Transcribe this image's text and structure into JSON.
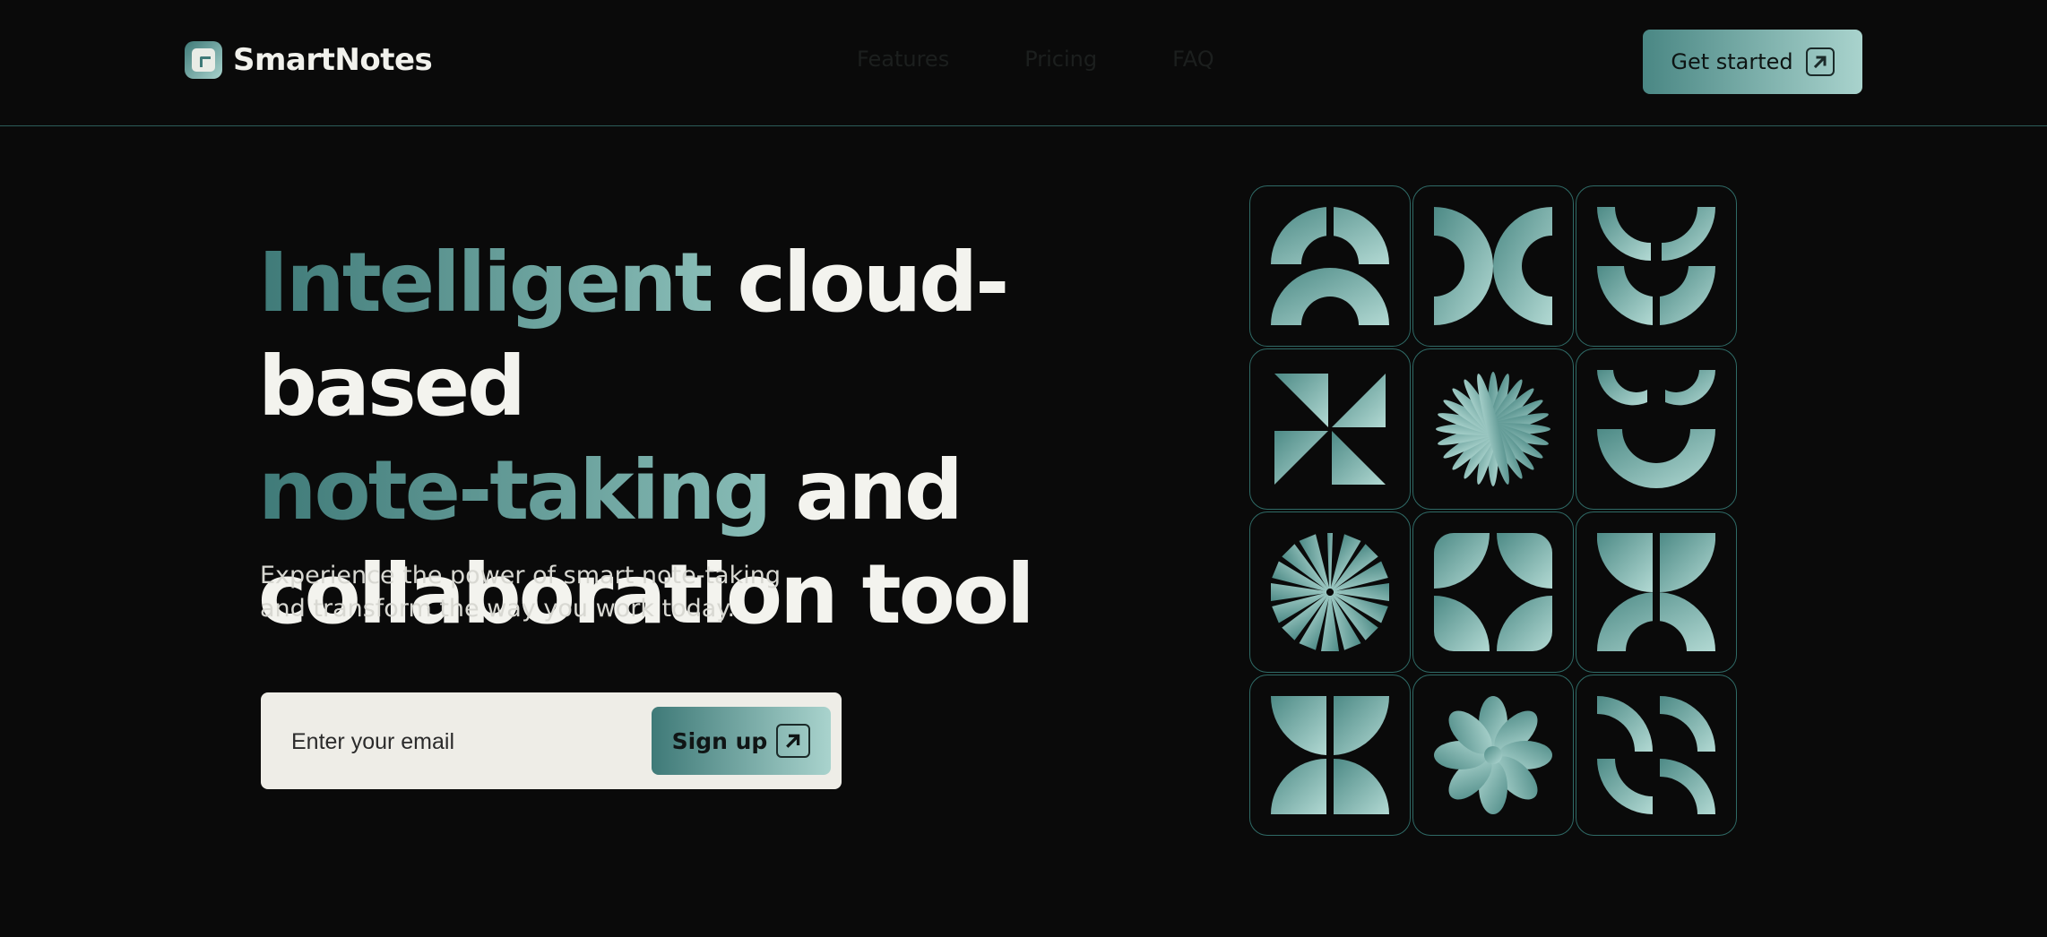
{
  "brand": {
    "name": "SmartNotes"
  },
  "nav": {
    "features": "Features",
    "pricing": "Pricing",
    "faq": "FAQ"
  },
  "header": {
    "cta_label": "Get started"
  },
  "hero": {
    "headline_accent_1": "Intelligent",
    "headline_plain_1": " cloud-based",
    "headline_accent_2": "note-taking",
    "headline_plain_2": " and",
    "headline_plain_3": "collaboration tool",
    "subtext": "Experience the power of smart note-taking and transform the way you work today."
  },
  "signup": {
    "placeholder": "Enter your email",
    "button_label": "Sign up"
  },
  "colors": {
    "accent_dark": "#3f7a78",
    "accent_light": "#a9d3cd",
    "background": "#0a0a0a",
    "text": "#efefe9"
  },
  "tiles": [
    "arches-icon",
    "brackets-icon",
    "leaves-icon",
    "pinwheel-icon",
    "burst-icon",
    "smile-arc-icon",
    "sunrays-icon",
    "quarter-petals-icon",
    "crossed-arches-icon",
    "split-leaves-icon",
    "flower-icon",
    "spiral-arcs-icon"
  ]
}
